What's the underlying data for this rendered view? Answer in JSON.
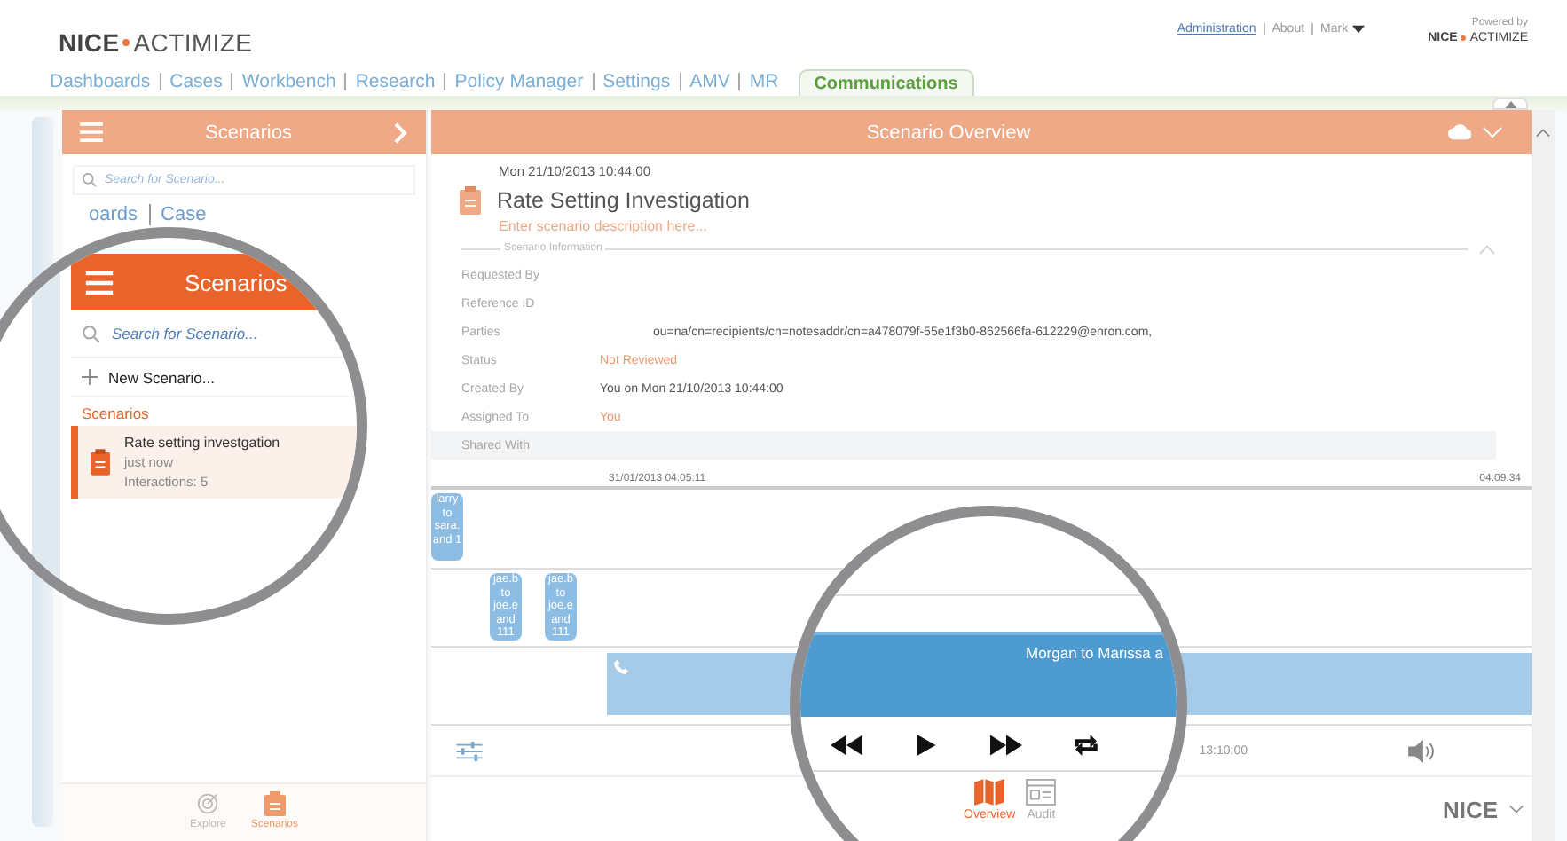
{
  "header": {
    "logo": "NICE",
    "logo_suffix": "ACTIMIZE",
    "links": [
      {
        "label": "Administration",
        "kind": "link"
      },
      {
        "label": "About",
        "kind": "text"
      },
      {
        "label": "Mark",
        "kind": "menu"
      }
    ],
    "powered_by": "Powered by",
    "powered_logo": "NICE",
    "powered_logo_suffix": "ACTIMIZE"
  },
  "nav_tabs": [
    {
      "label": "Dashboards",
      "selected": false
    },
    {
      "label": "Cases",
      "selected": false
    },
    {
      "label": "Workbench",
      "selected": false
    },
    {
      "label": "Research",
      "selected": false
    },
    {
      "label": "Policy Manager",
      "selected": false
    },
    {
      "label": "Settings",
      "selected": false
    },
    {
      "label": "AMV",
      "selected": false
    },
    {
      "label": "MR",
      "selected": false
    },
    {
      "label": "Communications",
      "selected": true
    }
  ],
  "sidebar": {
    "title": "Scenarios",
    "search": {
      "placeholder": "Search for Scenario..."
    },
    "bottom_tabs": [
      {
        "label": "Explore",
        "selected": false
      },
      {
        "label": "Scenarios",
        "selected": true
      }
    ]
  },
  "magnifier_left": {
    "fragments": [
      "oards",
      "Case"
    ],
    "title": "Scenarios",
    "search": {
      "placeholder": "Search for Scenario..."
    },
    "new_button": "New Scenario...",
    "section": "Scenarios",
    "items": [
      {
        "title": "Rate setting investgation",
        "time": "just now",
        "detail": "Interactions: 5",
        "selected": true
      }
    ]
  },
  "overview": {
    "title": "Scenario Overview",
    "date": "Mon 21/10/2013 10:44:00",
    "name": "Rate Setting Investigation",
    "description": {
      "placeholder": "Enter scenario description here..."
    },
    "section": "Scenario Information",
    "fields": [
      {
        "label": "Requested By"
      },
      {
        "label": "Reference ID"
      },
      {
        "label": "Parties",
        "value": "ou=na/cn=recipients/cn=notesaddr/cn=a478079f-55e1f3b0-862566fa-612229@enron.com,",
        "accent": false
      },
      {
        "label": "Status",
        "value": "Not Reviewed",
        "accent": true
      },
      {
        "label": "Created By",
        "value": "You on Mon 21/10/2013 10:44:00",
        "accent": false
      },
      {
        "label": "Assigned To",
        "value": "You",
        "accent": true
      },
      {
        "label": "Shared With"
      }
    ]
  },
  "timeline": {
    "start": "31/01/2013 04:05:11",
    "end": "04:09:34",
    "rows": [
      {
        "events": [
          {
            "label": "larry to sara. and 1"
          }
        ]
      },
      {
        "events": [
          {
            "label": "jae.b to joe.e and 111"
          },
          {
            "label": "jae.b to joe.e and 111"
          }
        ]
      },
      {
        "events": [],
        "call": {
          "kind": "phone"
        }
      }
    ]
  },
  "player": {
    "time": "13:10:00"
  },
  "magnifier_right": {
    "call_label": "Morgan to Marissa a",
    "view_tabs": [
      {
        "label": "Overview",
        "selected": true
      },
      {
        "label": "Audit",
        "selected": false
      }
    ]
  },
  "footer_logo": "NICE"
}
